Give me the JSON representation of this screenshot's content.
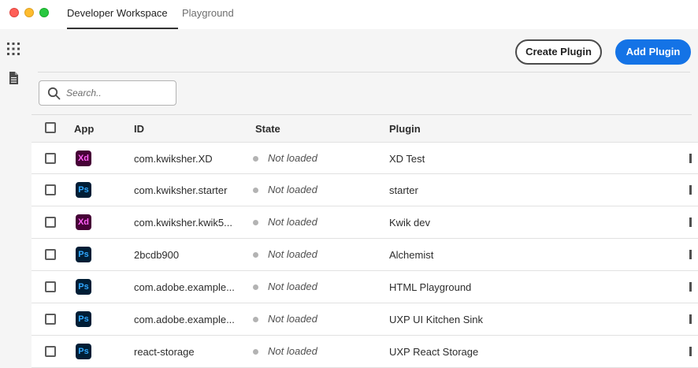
{
  "window": {
    "tabs": [
      {
        "label": "Developer Workspace",
        "active": true
      },
      {
        "label": "Playground",
        "active": false
      }
    ]
  },
  "sidebar": {
    "icons": [
      "grid-icon",
      "document-icon"
    ]
  },
  "toolbar": {
    "create_label": "Create Plugin",
    "add_label": "Add Plugin"
  },
  "search": {
    "placeholder": "Search..",
    "value": ""
  },
  "table": {
    "columns": {
      "app": "App",
      "id": "ID",
      "state": "State",
      "plugin": "Plugin"
    },
    "rows": [
      {
        "app": "Xd",
        "id": "com.kwiksher.XD",
        "state": "Not loaded",
        "plugin": "XD Test"
      },
      {
        "app": "Ps",
        "id": "com.kwiksher.starter",
        "state": "Not loaded",
        "plugin": "starter"
      },
      {
        "app": "Xd",
        "id": "com.kwiksher.kwik5...",
        "state": "Not loaded",
        "plugin": "Kwik dev"
      },
      {
        "app": "Ps",
        "id": "2bcdb900",
        "state": "Not loaded",
        "plugin": "Alchemist"
      },
      {
        "app": "Ps",
        "id": "com.adobe.example...",
        "state": "Not loaded",
        "plugin": "HTML Playground"
      },
      {
        "app": "Ps",
        "id": "com.adobe.example...",
        "state": "Not loaded",
        "plugin": "UXP UI Kitchen Sink"
      },
      {
        "app": "Ps",
        "id": "react-storage",
        "state": "Not loaded",
        "plugin": "UXP React Storage"
      }
    ]
  },
  "colors": {
    "accent": "#1473e6",
    "xd_bg": "#470137",
    "xd_fg": "#ff61f6",
    "ps_bg": "#001e36",
    "ps_fg": "#31a8ff",
    "state_dot": "#b3b3b3"
  }
}
